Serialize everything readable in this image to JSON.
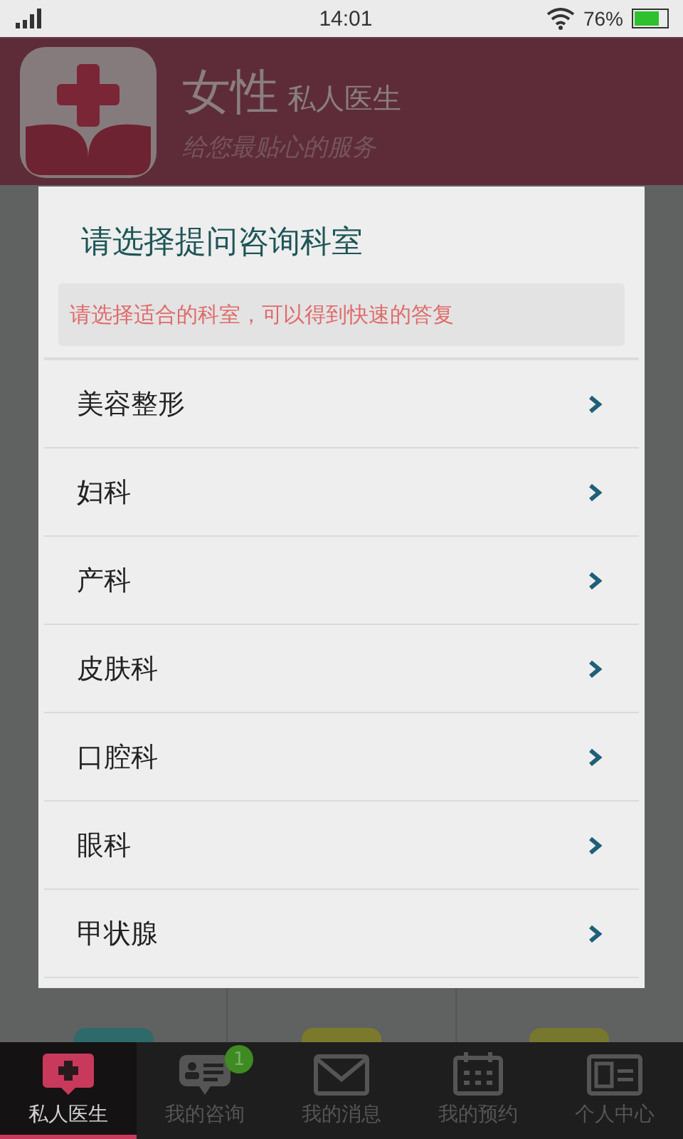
{
  "status_bar": {
    "time": "14:01",
    "battery": "76%"
  },
  "header": {
    "title": "女性",
    "subtitle": "私人医生",
    "slogan": "给您最贴心的服务"
  },
  "background_grid": [
    {
      "color": "#2e6a6a"
    },
    {
      "color": "#7b7a2c"
    },
    {
      "color": "#77782e"
    }
  ],
  "dialog": {
    "title": "请选择提问咨询科室",
    "hint": "请选择适合的科室，可以得到快速的答复",
    "items": [
      {
        "label": "美容整形"
      },
      {
        "label": "妇科"
      },
      {
        "label": "产科"
      },
      {
        "label": "皮肤科"
      },
      {
        "label": "口腔科"
      },
      {
        "label": "眼科"
      },
      {
        "label": "甲状腺"
      }
    ]
  },
  "nav": [
    {
      "label": "私人医生",
      "kind": "doctor",
      "selected": true
    },
    {
      "label": "我的咨询",
      "kind": "chat",
      "selected": false,
      "badge": "1"
    },
    {
      "label": "我的消息",
      "kind": "mail",
      "selected": false
    },
    {
      "label": "我的预约",
      "kind": "calendar",
      "selected": false
    },
    {
      "label": "个人中心",
      "kind": "card",
      "selected": false
    }
  ]
}
